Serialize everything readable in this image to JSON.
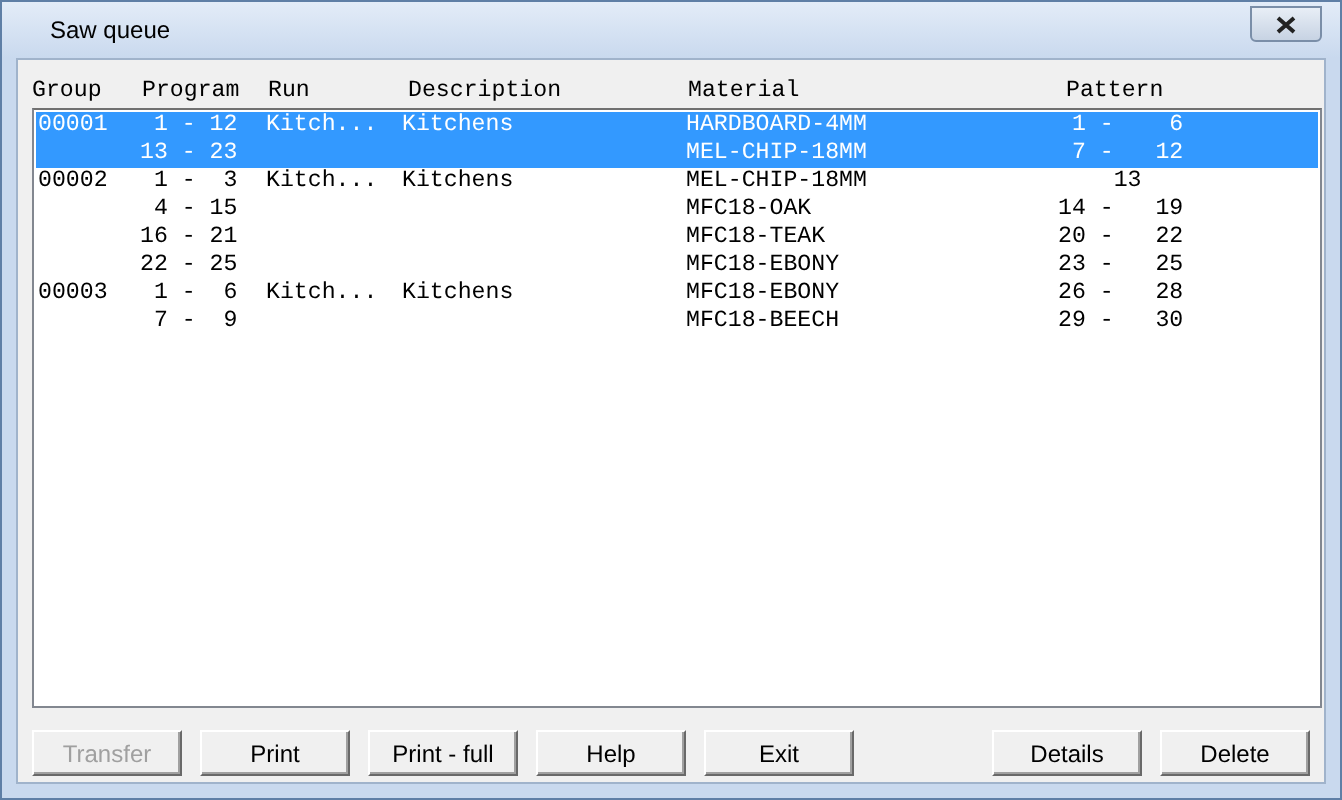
{
  "window": {
    "title": "Saw queue"
  },
  "columns": [
    "Group",
    "Program",
    "Run",
    "Description",
    "Material",
    "Pattern"
  ],
  "groups": [
    {
      "group": "00001",
      "run": "Kitch...",
      "description": "Kitchens",
      "selected": true,
      "lines": [
        {
          "program": " 1 - 12",
          "material": "HARDBOARD-4MM",
          "pattern": " 1 -    6"
        },
        {
          "program": "13 - 23",
          "material": "MEL-CHIP-18MM",
          "pattern": " 7 -   12"
        }
      ]
    },
    {
      "group": "00002",
      "run": "Kitch...",
      "description": "Kitchens",
      "selected": false,
      "lines": [
        {
          "program": " 1 -  3",
          "material": "MEL-CHIP-18MM",
          "pattern": "    13"
        },
        {
          "program": " 4 - 15",
          "material": "MFC18-OAK",
          "pattern": "14 -   19"
        },
        {
          "program": "16 - 21",
          "material": "MFC18-TEAK",
          "pattern": "20 -   22"
        },
        {
          "program": "22 - 25",
          "material": "MFC18-EBONY",
          "pattern": "23 -   25"
        }
      ]
    },
    {
      "group": "00003",
      "run": "Kitch...",
      "description": "Kitchens",
      "selected": false,
      "lines": [
        {
          "program": " 1 -  6",
          "material": "MFC18-EBONY",
          "pattern": "26 -   28"
        },
        {
          "program": " 7 -  9",
          "material": "MFC18-BEECH",
          "pattern": "29 -   30"
        }
      ]
    }
  ],
  "buttons": [
    {
      "label": "Transfer",
      "disabled": true
    },
    {
      "label": "Print",
      "disabled": false
    },
    {
      "label": "Print - full",
      "disabled": false
    },
    {
      "label": "Help",
      "disabled": false
    },
    {
      "label": "Exit",
      "disabled": false
    }
  ],
  "right_buttons": [
    {
      "label": "Details",
      "disabled": false
    },
    {
      "label": "Delete",
      "disabled": false
    }
  ]
}
